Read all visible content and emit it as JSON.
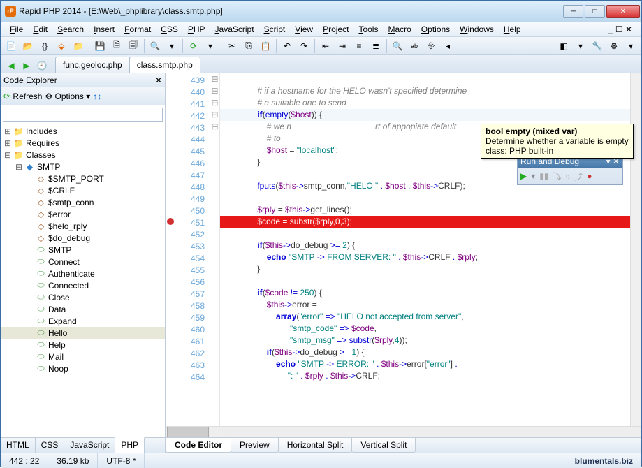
{
  "window": {
    "title": "Rapid PHP 2014 - [E:\\Web\\_phplibrary\\class.smtp.php]",
    "app_icon": "rP"
  },
  "menus": [
    "File",
    "Edit",
    "Search",
    "Insert",
    "Format",
    "CSS",
    "PHP",
    "JavaScript",
    "Script",
    "View",
    "Project",
    "Tools",
    "Macro",
    "Options",
    "Windows",
    "Help"
  ],
  "file_tabs": {
    "items": [
      "func.geoloc.php",
      "class.smtp.php"
    ],
    "active": 1
  },
  "explorer": {
    "title": "Code Explorer",
    "refresh": "Refresh",
    "options": "Options",
    "search_placeholder": "",
    "folders": [
      "Includes",
      "Requires",
      "Classes"
    ],
    "class": "SMTP",
    "fields": [
      "$SMTP_PORT",
      "$CRLF",
      "$smtp_conn",
      "$error",
      "$helo_rply",
      "$do_debug"
    ],
    "methods": [
      "SMTP",
      "Connect",
      "Authenticate",
      "Connected",
      "Close",
      "Data",
      "Expand",
      "Hello",
      "Help",
      "Mail",
      "Noop"
    ],
    "selected_method": "Hello",
    "bottom_tabs": [
      "HTML",
      "CSS",
      "JavaScript",
      "PHP"
    ],
    "bottom_active": 3
  },
  "tooltip": {
    "sig": "bool empty (mixed var)",
    "desc": "Determine whether a variable is empty",
    "cls": "class: PHP built-in"
  },
  "debug": {
    "title": "Run and Debug"
  },
  "code": {
    "start": 439,
    "lines": [
      {
        "n": 439,
        "t": ""
      },
      {
        "n": 440,
        "t": "                # if a hostname for the HELO wasn't specified determine",
        "cm": true
      },
      {
        "n": 441,
        "t": "                # a suitable one to send",
        "cm": true
      },
      {
        "n": 442,
        "t": "                if(empty($host)) {",
        "cur": true,
        "fold": "-"
      },
      {
        "n": 443,
        "t": "                    # we n                                    rt of appopiate default",
        "cm": true
      },
      {
        "n": 444,
        "t": "                    # to ",
        "cm": true
      },
      {
        "n": 445,
        "t": "                    $host = \"localhost\";"
      },
      {
        "n": 446,
        "t": "                }"
      },
      {
        "n": 447,
        "t": ""
      },
      {
        "n": 448,
        "t": "                fputs($this->smtp_conn,\"HELO \" . $host . $this->CRLF);"
      },
      {
        "n": 449,
        "t": ""
      },
      {
        "n": 450,
        "t": "                $rply = $this->get_lines();",
        "fold": "-"
      },
      {
        "n": 451,
        "t": "                $code = substr($rply,0,3);",
        "err": true,
        "bp": true
      },
      {
        "n": 452,
        "t": ""
      },
      {
        "n": 453,
        "t": "                if($this->do_debug >= 2) {",
        "fold": "-"
      },
      {
        "n": 454,
        "t": "                    echo \"SMTP -> FROM SERVER: \" . $this->CRLF . $rply;"
      },
      {
        "n": 455,
        "t": "                }"
      },
      {
        "n": 456,
        "t": ""
      },
      {
        "n": 457,
        "t": "                if($code != 250) {",
        "fold": "-"
      },
      {
        "n": 458,
        "t": "                    $this->error ="
      },
      {
        "n": 459,
        "t": "                        array(\"error\" => \"HELO not accepted from server\","
      },
      {
        "n": 460,
        "t": "                              \"smtp_code\" => $code,"
      },
      {
        "n": 461,
        "t": "                              \"smtp_msg\" => substr($rply,4));"
      },
      {
        "n": 462,
        "t": "                    if($this->do_debug >= 1) {",
        "fold": "-"
      },
      {
        "n": 463,
        "t": "                        echo \"SMTP -> ERROR: \" . $this->error[\"error\"] ."
      },
      {
        "n": 464,
        "t": "                             \": \" . $rply . $this->CRLF;"
      }
    ]
  },
  "editor_tabs": [
    "Code Editor",
    "Preview",
    "Horizontal Split",
    "Vertical Split"
  ],
  "status": {
    "pos": "442 : 22",
    "size": "36.19 kb",
    "enc": "UTF-8 *",
    "brand": "blumentals.biz"
  }
}
